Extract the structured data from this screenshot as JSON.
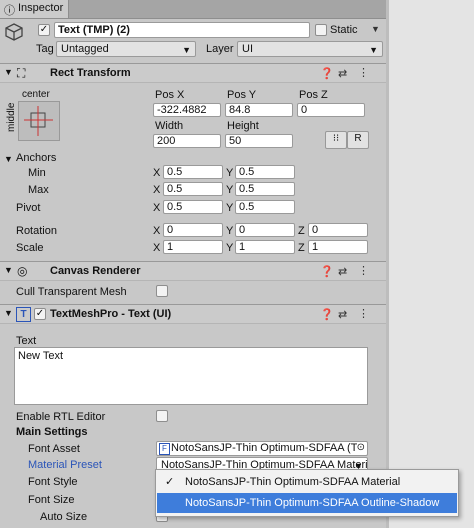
{
  "tab": {
    "title": "Inspector"
  },
  "header": {
    "object_name": "Text (TMP) (2)",
    "static_label": "Static",
    "tag_label": "Tag",
    "tag_value": "Untagged",
    "layer_label": "Layer",
    "layer_value": "UI"
  },
  "rect_transform": {
    "title": "Rect Transform",
    "anchor_h": "center",
    "anchor_v": "middle",
    "col1": "Pos X",
    "col2": "Pos Y",
    "col3": "Pos Z",
    "pos_x": "-322.4882",
    "pos_y": "84.8",
    "pos_z": "0",
    "width_label": "Width",
    "height_label": "Height",
    "width": "200",
    "height": "50",
    "r_button": "R",
    "anchors_label": "Anchors",
    "min_label": "Min",
    "min_x": "0.5",
    "min_y": "0.5",
    "max_label": "Max",
    "max_x": "0.5",
    "max_y": "0.5",
    "pivot_label": "Pivot",
    "pivot_x": "0.5",
    "pivot_y": "0.5",
    "rotation_label": "Rotation",
    "rot_x": "0",
    "rot_y": "0",
    "rot_z": "0",
    "scale_label": "Scale",
    "scale_x": "1",
    "scale_y": "1",
    "scale_z": "1",
    "x": "X",
    "y": "Y",
    "z": "Z"
  },
  "canvas_renderer": {
    "title": "Canvas Renderer",
    "cull_label": "Cull Transparent Mesh"
  },
  "tmp": {
    "title": "TextMeshPro - Text (UI)",
    "text_label": "Text",
    "text_value": "New Text",
    "rtl_label": "Enable RTL Editor",
    "main_settings": "Main Settings",
    "font_asset_label": "Font Asset",
    "font_asset_value": "NotoSansJP-Thin Optimum-SDFAA (TI",
    "material_preset_label": "Material Preset",
    "material_preset_value": "NotoSansJP-Thin Optimum-SDFAA Material",
    "font_style_label": "Font Style",
    "font_size_label": "Font Size",
    "auto_size_label": "Auto Size"
  },
  "dropdown_menu": {
    "items": [
      {
        "label": "NotoSansJP-Thin Optimum-SDFAA Material",
        "checked": "✓"
      },
      {
        "label": "NotoSansJP-Thin Optimum-SDFAA Outline-Shadow",
        "checked": ""
      }
    ]
  }
}
